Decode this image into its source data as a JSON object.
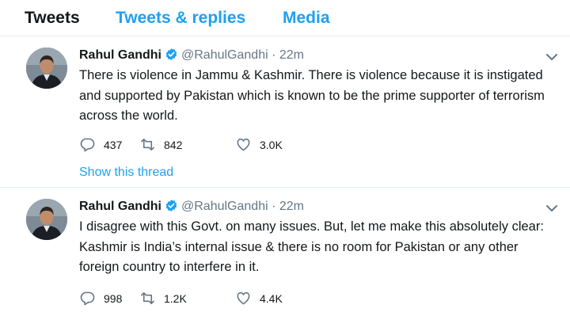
{
  "tabs": [
    "Tweets",
    "Tweets & replies",
    "Media"
  ],
  "colors": {
    "accent": "#1da1f2",
    "text": "#14171a",
    "muted": "#657786",
    "divider": "#e6ecf0"
  },
  "icons": {
    "verified": "verified-badge-icon",
    "caret": "chevron-down-icon",
    "reply": "reply-icon",
    "retweet": "retweet-icon",
    "like": "heart-icon"
  },
  "tweets": [
    {
      "name": "Rahul Gandhi",
      "handle": "@RahulGandhi",
      "dot": "·",
      "time": "22m",
      "text": "There is violence in Jammu & Kashmir. There is violence because it is instigated and supported by Pakistan which is known to be the prime supporter of terrorism across the world.",
      "replies": "437",
      "retweets": "842",
      "likes": "3.0K",
      "thread_link": "Show this thread"
    },
    {
      "name": "Rahul Gandhi",
      "handle": "@RahulGandhi",
      "dot": "·",
      "time": "22m",
      "text": "I disagree with this Govt. on many issues. But, let me make this absolutely clear: Kashmir is India’s internal issue & there is no room for Pakistan or any other foreign country to interfere in it.",
      "replies": "998",
      "retweets": "1.2K",
      "likes": "4.4K"
    }
  ]
}
